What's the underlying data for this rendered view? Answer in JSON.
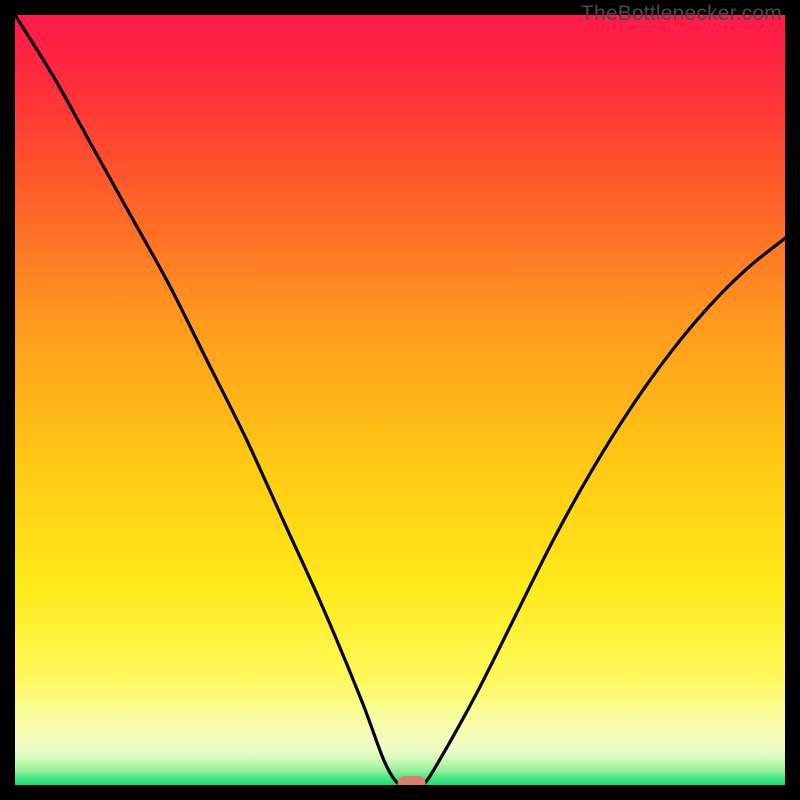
{
  "watermark": "TheBottlenecker.com",
  "colors": {
    "curve": "#000000",
    "marker": "#d8816f",
    "green_band": "#22e07a",
    "pale_band": "#f6fccf",
    "bg_top": "#ff1a4b",
    "bg_mid": "#ffd400",
    "bg_low": "#fff95a"
  },
  "chart_data": {
    "type": "line",
    "title": "",
    "xlabel": "",
    "ylabel": "",
    "xlim": [
      0,
      100
    ],
    "ylim": [
      0,
      100
    ],
    "series": [
      {
        "name": "bottleneck-curve",
        "x": [
          0,
          5,
          10,
          15,
          20,
          25,
          30,
          35,
          40,
          45,
          48,
          50,
          52,
          53,
          55,
          60,
          65,
          70,
          75,
          80,
          85,
          90,
          95,
          100
        ],
        "y": [
          100,
          92,
          83,
          74,
          65,
          55,
          45,
          34,
          23,
          11,
          3,
          0,
          0,
          0,
          3,
          12,
          22,
          32,
          41,
          49,
          56,
          62,
          67,
          71
        ]
      }
    ],
    "marker": {
      "x": 51.5,
      "y": 0
    }
  }
}
